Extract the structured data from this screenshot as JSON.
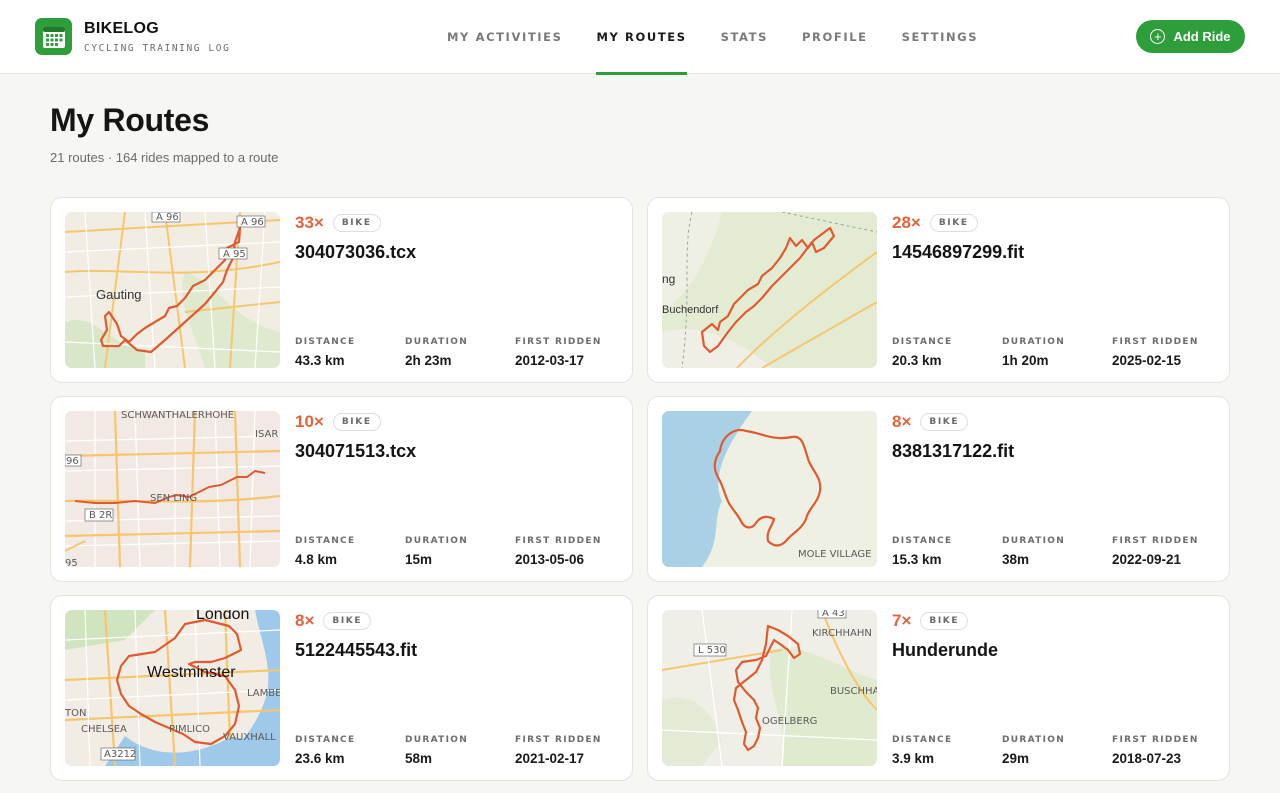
{
  "app": {
    "name": "BIKELOG",
    "tagline": "CYCLING TRAINING LOG"
  },
  "nav": [
    {
      "label": "MY ACTIVITIES",
      "active": false
    },
    {
      "label": "MY ROUTES",
      "active": true
    },
    {
      "label": "STATS",
      "active": false
    },
    {
      "label": "PROFILE",
      "active": false
    },
    {
      "label": "SETTINGS",
      "active": false
    }
  ],
  "add_button": {
    "label": "Add Ride",
    "icon": "plus-circle-icon"
  },
  "page": {
    "title": "My Routes",
    "subtitle": "21 routes · 164 rides mapped to a route"
  },
  "stat_labels": {
    "distance": "DISTANCE",
    "duration": "DURATION",
    "first": "FIRST RIDDEN"
  },
  "colors": {
    "accent": "#2e9e3a",
    "count": "#e5633a",
    "route": "#e05a2f"
  },
  "routes": [
    {
      "count": "33×",
      "type": "BIKE",
      "name": "304073036.tcx",
      "distance": "43.3 km",
      "duration": "2h 23m",
      "first_ridden": "2012-03-17",
      "map_labels": [
        "A 96",
        "A 96",
        "A 95",
        "Gauting"
      ]
    },
    {
      "count": "28×",
      "type": "BIKE",
      "name": "14546897299.fit",
      "distance": "20.3 km",
      "duration": "1h 20m",
      "first_ridden": "2025-02-15",
      "map_labels": [
        "ng",
        "Buchendorf"
      ]
    },
    {
      "count": "10×",
      "type": "BIKE",
      "name": "304071513.tcx",
      "distance": "4.8 km",
      "duration": "15m",
      "first_ridden": "2013-05-06",
      "map_labels": [
        "SCHWANTHALERHOHE",
        "ISAR",
        "96",
        "SEN LING",
        "B 2R",
        "95"
      ]
    },
    {
      "count": "8×",
      "type": "BIKE",
      "name": "8381317122.fit",
      "distance": "15.3 km",
      "duration": "38m",
      "first_ridden": "2022-09-21",
      "map_labels": [
        "MOLE VILLAGE"
      ]
    },
    {
      "count": "8×",
      "type": "BIKE",
      "name": "5122445543.fit",
      "distance": "23.6 km",
      "duration": "58m",
      "first_ridden": "2021-02-17",
      "map_labels": [
        "London",
        "Westminster",
        "LAMBE",
        "TON",
        "CHELSEA",
        "PIMLICO",
        "VAUXHALL",
        "A3212"
      ]
    },
    {
      "count": "7×",
      "type": "BIKE",
      "name": "Hunderunde",
      "distance": "3.9 km",
      "duration": "29m",
      "first_ridden": "2018-07-23",
      "map_labels": [
        "A 43",
        "KIRCHHAHN",
        "L 530",
        "BUSCHHA",
        "OGELBERG"
      ]
    }
  ]
}
